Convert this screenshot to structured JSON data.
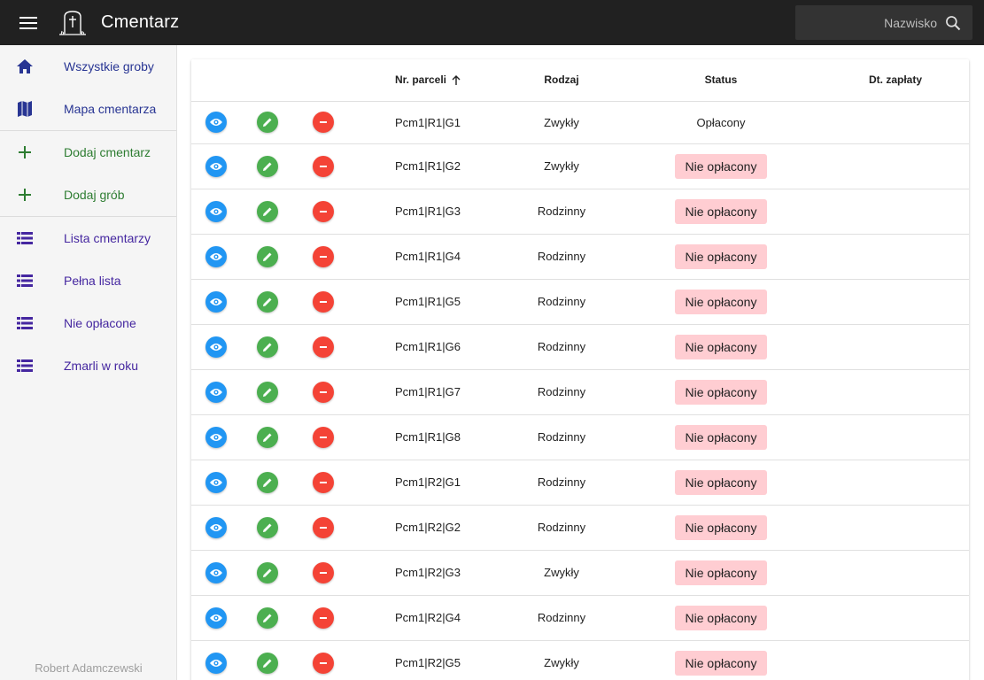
{
  "app": {
    "title": "Cmentarz"
  },
  "search": {
    "placeholder": "Nazwisko"
  },
  "sidebar": {
    "items": [
      {
        "label": "Wszystkie groby",
        "icon": "home-icon",
        "color": "#283593"
      },
      {
        "label": "Mapa cmentarza",
        "icon": "map-icon",
        "color": "#283593"
      },
      {
        "label": "Dodaj cmentarz",
        "icon": "plus-icon",
        "color": "#2e7d32"
      },
      {
        "label": "Dodaj grób",
        "icon": "plus-icon",
        "color": "#2e7d32"
      },
      {
        "label": "Lista cmentarzy",
        "icon": "list-icon",
        "color": "#4527a0"
      },
      {
        "label": "Pełna lista",
        "icon": "list-icon",
        "color": "#4527a0"
      },
      {
        "label": "Nie opłacone",
        "icon": "list-icon",
        "color": "#4527a0"
      },
      {
        "label": "Zmarli w roku",
        "icon": "list-icon",
        "color": "#4527a0"
      }
    ],
    "footer": "Robert Adamczewski"
  },
  "table": {
    "headers": {
      "parcel": "Nr. parceli",
      "type": "Rodzaj",
      "status": "Status",
      "payment_date": "Dt. zapłaty"
    },
    "rows": [
      {
        "parcel": "Pcm1|R1|G1",
        "type": "Zwykły",
        "status": "Opłacony",
        "paid": true,
        "payment_date": ""
      },
      {
        "parcel": "Pcm1|R1|G2",
        "type": "Zwykły",
        "status": "Nie opłacony",
        "paid": false,
        "payment_date": ""
      },
      {
        "parcel": "Pcm1|R1|G3",
        "type": "Rodzinny",
        "status": "Nie opłacony",
        "paid": false,
        "payment_date": ""
      },
      {
        "parcel": "Pcm1|R1|G4",
        "type": "Rodzinny",
        "status": "Nie opłacony",
        "paid": false,
        "payment_date": ""
      },
      {
        "parcel": "Pcm1|R1|G5",
        "type": "Rodzinny",
        "status": "Nie opłacony",
        "paid": false,
        "payment_date": ""
      },
      {
        "parcel": "Pcm1|R1|G6",
        "type": "Rodzinny",
        "status": "Nie opłacony",
        "paid": false,
        "payment_date": ""
      },
      {
        "parcel": "Pcm1|R1|G7",
        "type": "Rodzinny",
        "status": "Nie opłacony",
        "paid": false,
        "payment_date": ""
      },
      {
        "parcel": "Pcm1|R1|G8",
        "type": "Rodzinny",
        "status": "Nie opłacony",
        "paid": false,
        "payment_date": ""
      },
      {
        "parcel": "Pcm1|R2|G1",
        "type": "Rodzinny",
        "status": "Nie opłacony",
        "paid": false,
        "payment_date": ""
      },
      {
        "parcel": "Pcm1|R2|G2",
        "type": "Rodzinny",
        "status": "Nie opłacony",
        "paid": false,
        "payment_date": ""
      },
      {
        "parcel": "Pcm1|R2|G3",
        "type": "Zwykły",
        "status": "Nie opłacony",
        "paid": false,
        "payment_date": ""
      },
      {
        "parcel": "Pcm1|R2|G4",
        "type": "Rodzinny",
        "status": "Nie opłacony",
        "paid": false,
        "payment_date": ""
      },
      {
        "parcel": "Pcm1|R2|G5",
        "type": "Zwykły",
        "status": "Nie opłacony",
        "paid": false,
        "payment_date": ""
      }
    ]
  },
  "colors": {
    "view": "#2196f3",
    "edit": "#4caf50",
    "delete": "#f44336",
    "unpaid_badge": "#ffcdd2"
  }
}
